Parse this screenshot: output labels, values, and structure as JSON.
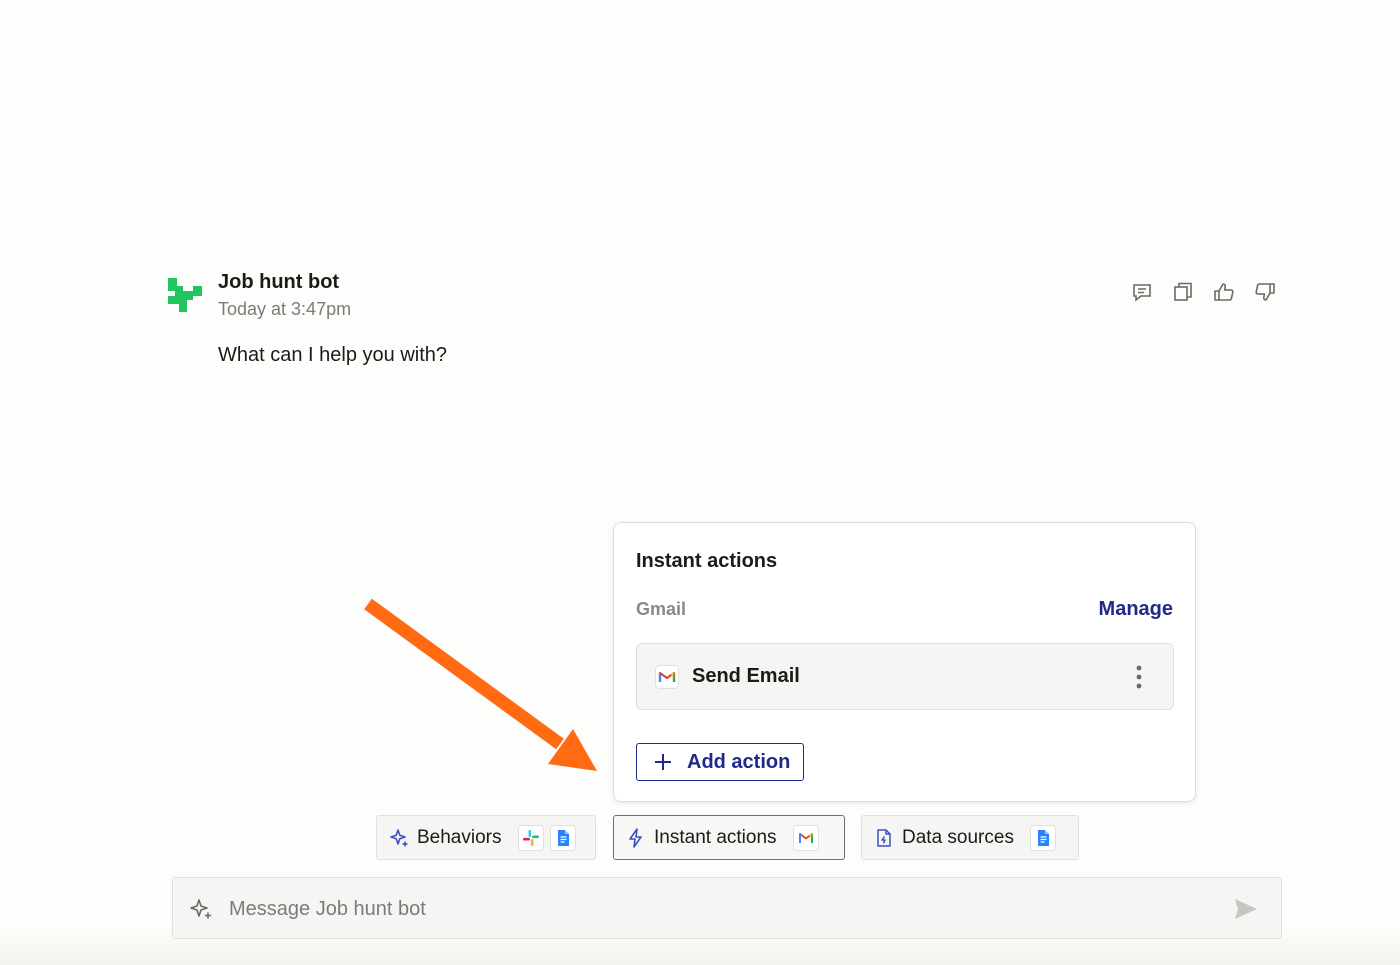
{
  "message": {
    "bot_name": "Job hunt bot",
    "timestamp": "Today at 3:47pm",
    "text": "What can I help you with?",
    "actions": [
      "comment-icon",
      "copy-icon",
      "thumbs-up-icon",
      "thumbs-down-icon"
    ]
  },
  "popover": {
    "title": "Instant actions",
    "app_label": "Gmail",
    "manage_label": "Manage",
    "action_label": "Send Email",
    "add_action_label": "Add action"
  },
  "chips": {
    "behaviors": "Behaviors",
    "instant_actions": "Instant actions",
    "data_sources": "Data sources"
  },
  "composer": {
    "placeholder": "Message Job hunt bot"
  },
  "colors": {
    "accent": "#1f2a8a",
    "brand_green": "#22c55e",
    "annotation_arrow": "#ff6a13"
  }
}
